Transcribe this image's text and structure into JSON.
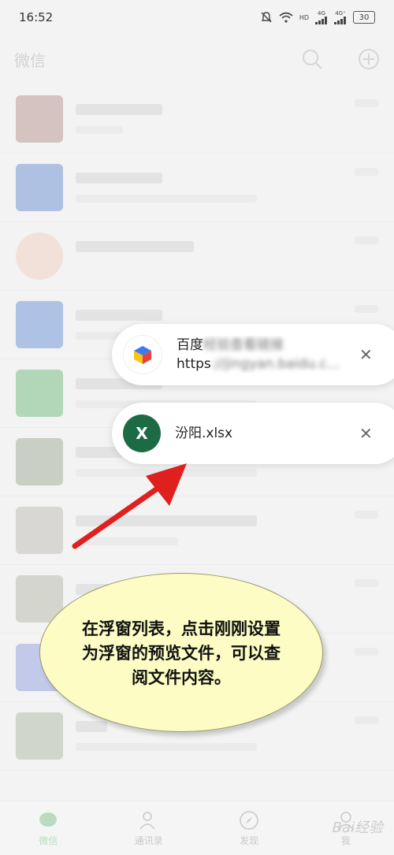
{
  "status_bar": {
    "time": "16:52",
    "network1": "4G",
    "network2": "4G⁺",
    "hd": "HD",
    "battery": "30"
  },
  "app": {
    "title": "微信"
  },
  "tabs": [
    {
      "label": "微信"
    },
    {
      "label": "通讯录"
    },
    {
      "label": "发现"
    },
    {
      "label": "我"
    }
  ],
  "float_list": [
    {
      "title": "百度",
      "title_blurred": "经验查看链接",
      "subtitle_prefix": "https",
      "subtitle_blurred": "://jingyan.baidu.c...",
      "close": "✕"
    },
    {
      "icon_letter": "X",
      "title": "汾阳.xlsx",
      "close": "✕"
    }
  ],
  "annotation": {
    "text": "在浮窗列表，点击刚刚设置为浮窗的预览文件，可以查阅文件内容。"
  },
  "watermark": "Bai经验",
  "colors": {
    "excel_green": "#1d6b44",
    "arrow_red": "#e01f1f",
    "callout_fill": "#fcfcc4"
  }
}
